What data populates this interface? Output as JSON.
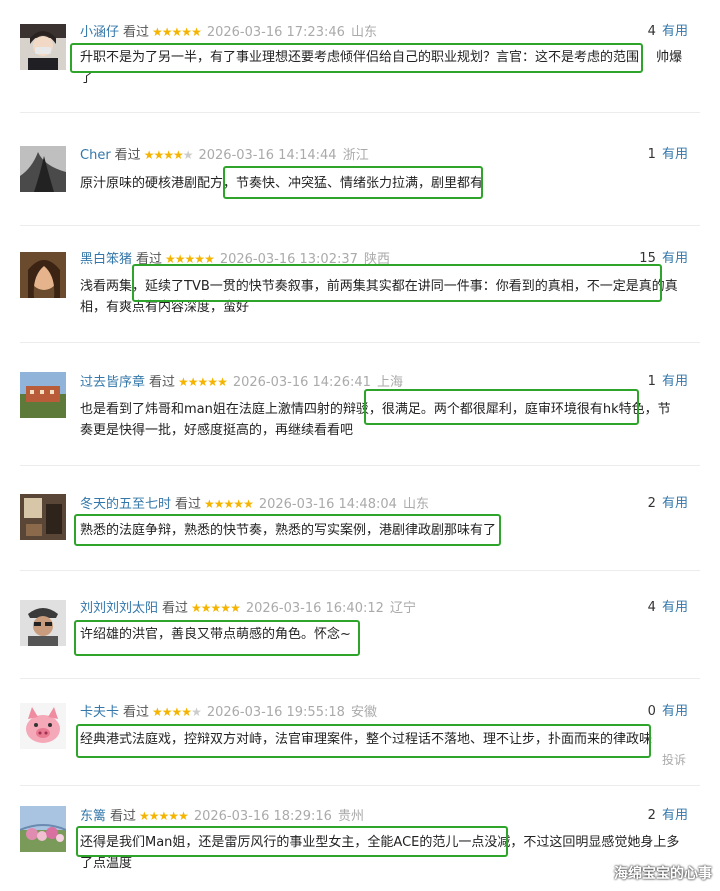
{
  "reviews": [
    {
      "user": "小涵仔",
      "watched": "看过",
      "stars_on": "★★★★★",
      "stars_off": "",
      "time": "2026-03-16 17:23:46",
      "location": "山东",
      "useful_count": "4",
      "useful_label": "有用",
      "text": "升职不是为了另一半，有了事业理想还要考虑倾伴侣给自己的职业规划？言官：这不是考虑的范围！ 帅爆了"
    },
    {
      "user": "Cher",
      "watched": "看过",
      "stars_on": "★★★★",
      "stars_off": "★",
      "time": "2026-03-16 14:14:44",
      "location": "浙江",
      "useful_count": "1",
      "useful_label": "有用",
      "text": "原汁原味的硬核港剧配方，节奏快、冲突猛、情绪张力拉满，剧里都有"
    },
    {
      "user": "黑白笨猪",
      "watched": "看过",
      "stars_on": "★★★★★",
      "stars_off": "",
      "time": "2026-03-16 13:02:37",
      "location": "陕西",
      "useful_count": "15",
      "useful_label": "有用",
      "text": "浅看两集，延续了TVB一贯的快节奏叙事，前两集其实都在讲同一件事：你看到的真相，不一定是真的真相，有爽点有内容深度，蛮好"
    },
    {
      "user": "过去皆序章",
      "watched": "看过",
      "stars_on": "★★★★★",
      "stars_off": "",
      "time": "2026-03-16 14:26:41",
      "location": "上海",
      "useful_count": "1",
      "useful_label": "有用",
      "text": "也是看到了炜哥和man姐在法庭上激情四射的辩驳，很满足。两个都很犀利，庭审环境很有hk特色，节奏更是快得一批，好感度挺高的，再继续看看吧"
    },
    {
      "user": "冬天的五至七时",
      "watched": "看过",
      "stars_on": "★★★★★",
      "stars_off": "",
      "time": "2026-03-16 14:48:04",
      "location": "山东",
      "useful_count": "2",
      "useful_label": "有用",
      "text": "熟悉的法庭争辩，熟悉的快节奏，熟悉的写实案例，港剧律政剧那味有了"
    },
    {
      "user": "刘刘刘刘太阳",
      "watched": "看过",
      "stars_on": "★★★★★",
      "stars_off": "",
      "time": "2026-03-16 16:40:12",
      "location": "辽宁",
      "useful_count": "4",
      "useful_label": "有用",
      "text": "许绍雄的洪官，善良又带点萌感的角色。怀念~"
    },
    {
      "user": "卡夫卡",
      "watched": "看过",
      "stars_on": "★★★★",
      "stars_off": "★",
      "time": "2026-03-16 19:55:18",
      "location": "安徽",
      "useful_count": "0",
      "useful_label": "有用",
      "text": "经典港式法庭戏，控辩双方对峙，法官审理案件，整个过程话不落地、理不让步，扑面而来的律政味"
    },
    {
      "user": "东篱",
      "watched": "看过",
      "stars_on": "★★★★★",
      "stars_off": "",
      "time": "2026-03-16 18:29:16",
      "location": "贵州",
      "useful_count": "2",
      "useful_label": "有用",
      "text": "还得是我们Man姐，还是雷厉风行的事业型女主，全能ACE的范儿一点没减，不过这回明显感觉她身上多了点温度"
    }
  ],
  "report_label": "投诉",
  "watermark": "海绵宝宝的心事",
  "colors": {
    "highlight_box": "#2ea52a",
    "username": "#3377aa",
    "star": "#f4b400"
  }
}
